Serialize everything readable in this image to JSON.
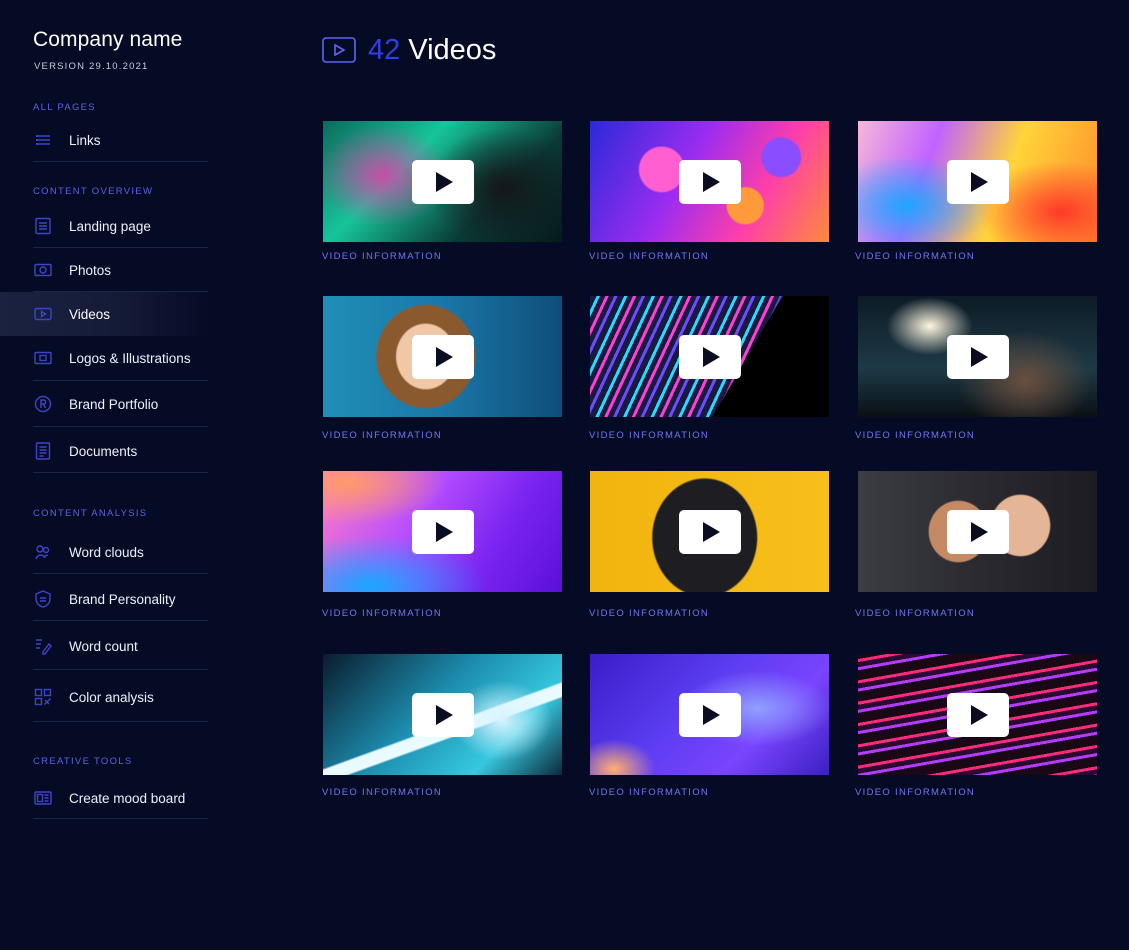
{
  "sidebar": {
    "company_name": "Company name",
    "version": "VERSION 29.10.2021",
    "sections": [
      {
        "label": "ALL PAGES",
        "items": [
          {
            "label": "Links",
            "icon": "list-icon"
          }
        ]
      },
      {
        "label": "CONTENT OVERVIEW",
        "items": [
          {
            "label": "Landing page",
            "icon": "page-icon"
          },
          {
            "label": "Photos",
            "icon": "photo-icon"
          },
          {
            "label": "Videos",
            "icon": "video-icon",
            "active": true
          },
          {
            "label": "Logos & Illustrations",
            "icon": "logo-icon"
          },
          {
            "label": "Brand Portfolio",
            "icon": "registered-icon"
          },
          {
            "label": "Documents",
            "icon": "document-icon"
          }
        ]
      },
      {
        "label": "CONTENT ANALYSIS",
        "items": [
          {
            "label": "Word clouds",
            "icon": "word-cloud-icon"
          },
          {
            "label": "Brand Personality",
            "icon": "brand-personality-icon"
          },
          {
            "label": "Word count",
            "icon": "word-count-icon"
          },
          {
            "label": "Color analysis",
            "icon": "color-analysis-icon"
          }
        ]
      },
      {
        "label": "CREATIVE TOOLS",
        "items": [
          {
            "label": "Create mood board",
            "icon": "mood-board-icon"
          }
        ]
      }
    ]
  },
  "header": {
    "icon": "video-icon",
    "count": "42",
    "title": "Videos"
  },
  "videos": [
    {
      "info_label": "VIDEO INFORMATION",
      "thumbnail": "neon-portrait-green"
    },
    {
      "info_label": "VIDEO INFORMATION",
      "thumbnail": "colorful-oil-bubbles"
    },
    {
      "info_label": "VIDEO INFORMATION",
      "thumbnail": "abstract-color-waves"
    },
    {
      "info_label": "VIDEO INFORMATION",
      "thumbnail": "curly-hair-woman-blue"
    },
    {
      "info_label": "VIDEO INFORMATION",
      "thumbnail": "neon-diagonal-lines"
    },
    {
      "info_label": "VIDEO INFORMATION",
      "thumbnail": "sparks-tattoo-arm"
    },
    {
      "info_label": "VIDEO INFORMATION",
      "thumbnail": "purple-gradient-waves"
    },
    {
      "info_label": "VIDEO INFORMATION",
      "thumbnail": "pug-yellow"
    },
    {
      "info_label": "VIDEO INFORMATION",
      "thumbnail": "couple-selfie"
    },
    {
      "info_label": "VIDEO INFORMATION",
      "thumbnail": "cyan-skull"
    },
    {
      "info_label": "VIDEO INFORMATION",
      "thumbnail": "blue-purple-fluid"
    },
    {
      "info_label": "VIDEO INFORMATION",
      "thumbnail": "pink-light-streaks"
    }
  ],
  "colors": {
    "background": "#050b24",
    "accent": "#2f3fe0",
    "section_label": "#5b62e6",
    "icon": "#3c45c9",
    "info_label": "#6f78f0"
  }
}
